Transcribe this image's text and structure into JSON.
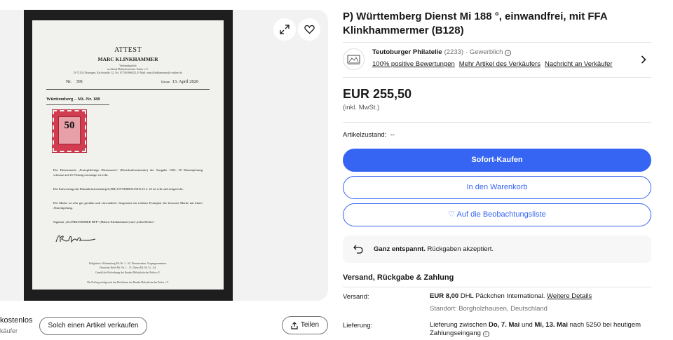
{
  "listing": {
    "title": "P) Württemberg Dienst Mi 188 °, einwandfrei, mit FFA Klinkhammermer (B128)",
    "price": "EUR 255,50",
    "tax_note": "(inkl. MwSt.)",
    "condition_label": "Artikelzustand:",
    "condition_value": "--"
  },
  "certificate": {
    "title": "ATTEST",
    "name": "MARC KLINKHAMMER",
    "sub_line1": "Verbandsprüfer",
    "sub_line2": "im Bund Philatelistischer Prüfer e.V.",
    "sub_line3": "D-71254 Ditzingen, Kirchstraße 12, Tel. 07156/966922, E-Mail: marcklinkhammer@t-online.de",
    "nr_label": "Nr.",
    "nr_value": "391",
    "date_label": "Datum",
    "date_value": "13. April 2026",
    "heading": "Württemberg – Mi.-Nr. 188",
    "stamp_value": "50",
    "para1": "Die Dienstmarke „Portopflichtige Dienstsache“ (Bezirksdienstmarke) der Ausgabe 1923, 50 Rentenpfennig schwarz auf 25 Pfennig rotorange, ist echt.",
    "para2": "Die Entwertung mit Datumbrückenstempel (DB) UNTERHAUSEN 23 2. 25 ist echt und zeitgerecht.",
    "para3": "Die Marke ist sehr gut gezähnt und einwandfrei. Insgesamt ein schönes Exemplar der besseren Marke mit klarer Abstempelung.",
    "para4": "Signatur „KLINKHAMMER BPP“ (Hubert Klinkhammer) und „Infla-Berlin“.",
    "signature": "Klinkhammer",
    "footer1": "Prüfgebiete: Württemberg Mi.-Nr. 1 – 62, Dienstmarken, Vorgangsnummern.",
    "footer2": "Deutsches Reich Mi.-Nr. 1 – 51, Dienst Mi.-Nr. 52 – 64.",
    "footer3": "Gemäß der Prüfordnung des Bundes Philatelistischer Prüfer e.V.",
    "footer4": "Die Prüfung erfolgt nach den Richtlinien des Bundes Philatelistischer Prüfer e.V."
  },
  "gallery": {
    "free_text": "kostenlos",
    "buyer_text": "käufer",
    "sell_button": "Solch einen Artikel verkaufen",
    "share_button": "Teilen"
  },
  "seller": {
    "name": "Teutoburger Philatelie",
    "count": "(2233)",
    "type": "· Gewerblich",
    "positive": "100% positive Bewertungen",
    "more_items": "Mehr Artikel des Verkäufers",
    "contact": "Nachricht an Verkäufer"
  },
  "buttons": {
    "buy_now": "Sofort-Kaufen",
    "add_to_cart": "In den Warenkorb",
    "watchlist": "♡ Auf die Beobachtungsliste"
  },
  "returns": {
    "bold": "Ganz entspannt.",
    "text": " Rückgaben akzeptiert."
  },
  "shipping": {
    "section_title": "Versand, Rückgabe & Zahlung",
    "shipping_label": "Versand:",
    "shipping_price": "EUR 8,00",
    "shipping_method": " DHL Päckchen International.",
    "shipping_more": "Weitere Details",
    "location": "Standort: Borgholzhausen, Deutschland",
    "delivery_label": "Lieferung:",
    "delivery_prefix": "Lieferung zwischen ",
    "delivery_date1": "Do, 7. Mai",
    "delivery_and": " und ",
    "delivery_date2": "Mi, 13. Mai",
    "delivery_suffix": " nach 5250 bei heutigem",
    "delivery_line2": "Zahlungseingang"
  },
  "colors": {
    "primary": "#3665f3",
    "stamp_red": "#d23c50"
  }
}
